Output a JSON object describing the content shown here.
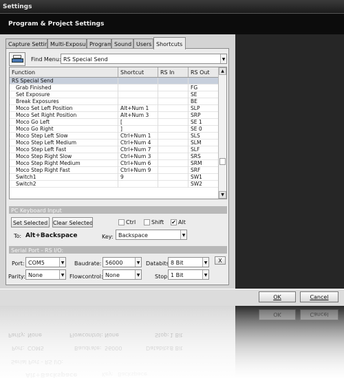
{
  "window": {
    "title": "Settings"
  },
  "header": {
    "title": "Program & Project Settings"
  },
  "tabs": [
    {
      "label": "Capture Settings"
    },
    {
      "label": "Multi-Exposure"
    },
    {
      "label": "Program"
    },
    {
      "label": "Sound"
    },
    {
      "label": "Users"
    },
    {
      "label": "Shortcuts",
      "active": true
    }
  ],
  "find": {
    "label": "Find Menu:",
    "value": "RS Special Send",
    "icon": "printer-icon"
  },
  "table": {
    "columns": [
      "Function",
      "Shortcut",
      "RS In",
      "RS Out"
    ],
    "rows": [
      {
        "function": "RS Special Send",
        "shortcut": "",
        "rs_in": "",
        "rs_out": "",
        "group": true
      },
      {
        "function": "Grab Finished",
        "shortcut": "",
        "rs_in": "",
        "rs_out": "FG"
      },
      {
        "function": "Set Exposure",
        "shortcut": "",
        "rs_in": "",
        "rs_out": "SE"
      },
      {
        "function": "Break Exposures",
        "shortcut": "",
        "rs_in": "",
        "rs_out": "BE"
      },
      {
        "function": "Moco Set Left Position",
        "shortcut": "Alt+Num 1",
        "rs_in": "",
        "rs_out": "SLP"
      },
      {
        "function": "Moco Set Right Position",
        "shortcut": "Alt+Num 3",
        "rs_in": "",
        "rs_out": "SRP"
      },
      {
        "function": "Moco Go Left",
        "shortcut": "[",
        "rs_in": "",
        "rs_out": "SE 1"
      },
      {
        "function": "Moco Go Right",
        "shortcut": "]",
        "rs_in": "",
        "rs_out": "SE 0"
      },
      {
        "function": "Moco Step Left Slow",
        "shortcut": "Ctrl+Num 1",
        "rs_in": "",
        "rs_out": "SLS"
      },
      {
        "function": "Moco Step Left Medium",
        "shortcut": "Ctrl+Num 4",
        "rs_in": "",
        "rs_out": "SLM"
      },
      {
        "function": "Moco Step Left Fast",
        "shortcut": "Ctrl+Num 7",
        "rs_in": "",
        "rs_out": "SLF"
      },
      {
        "function": "Moco Step Right Slow",
        "shortcut": "Ctrl+Num 3",
        "rs_in": "",
        "rs_out": "SRS"
      },
      {
        "function": "Moco Step Right Medium",
        "shortcut": "Ctrl+Num 6",
        "rs_in": "",
        "rs_out": "SRM"
      },
      {
        "function": "Moco Step Right Fast",
        "shortcut": "Ctrl+Num 9",
        "rs_in": "",
        "rs_out": "SRF"
      },
      {
        "function": "Switch1",
        "shortcut": "9",
        "rs_in": "",
        "rs_out": "SW1"
      },
      {
        "function": "Switch2",
        "shortcut": "",
        "rs_in": "",
        "rs_out": "SW2"
      }
    ]
  },
  "pc_keyboard": {
    "title": "PC Keyboard Input",
    "set_selected": "Set Selected",
    "clear_selected": "Clear Selected",
    "ctrl": {
      "label": "Ctrl",
      "checked": false
    },
    "shift": {
      "label": "Shift",
      "checked": false
    },
    "alt": {
      "label": "Alt",
      "checked": true
    },
    "to_label": "To:",
    "to_value": "Alt+Backspace",
    "key_label": "Key:",
    "key_value": "Backspace"
  },
  "serial": {
    "title": "Serial Port - RS I/O:",
    "port_label": "Port:",
    "port_value": "COM5",
    "baud_label": "Baudrate:",
    "baud_value": "56000",
    "databits_label": "Databits:",
    "databits_value": "8 Bit",
    "close": "X",
    "parity_label": "Parity:",
    "parity_value": "None",
    "flow_label": "Flowcontrol:",
    "flow_value": "None",
    "stop_label": "Stop:",
    "stop_value": "1 Bit"
  },
  "footer": {
    "ok": "OK",
    "cancel": "Cancel"
  }
}
